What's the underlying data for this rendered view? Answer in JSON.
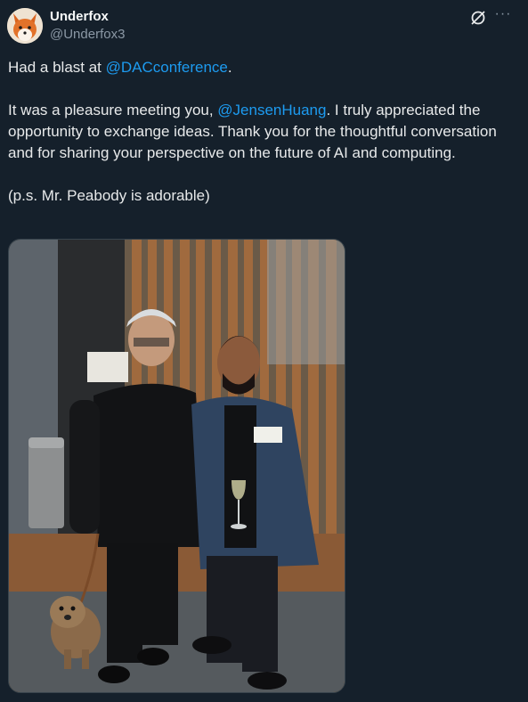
{
  "author": {
    "name": "Underfox",
    "handle": "@Underfox3",
    "avatar_icon": "fox-avatar-icon"
  },
  "actions": {
    "grok_icon": "grok-icon",
    "more_icon": "more-icon",
    "more_label": "···"
  },
  "tweet": {
    "line1_prefix": "Had a blast at ",
    "line1_mention": "@DACconference",
    "line1_suffix": ".",
    "para2_prefix": "It was a pleasure meeting you, ",
    "para2_mention": "@JensenHuang",
    "para2_suffix": ". I truly appreciated the opportunity to exchange ideas. Thank you for the thoughtful conversation and for sharing your perspective on the future of AI and computing.",
    "para3": "(p.s. Mr. Peabody is adorable)"
  },
  "colors": {
    "background": "#15202b",
    "text": "#e7e9ea",
    "secondary": "#8b98a5",
    "link": "#1d9bf0"
  }
}
